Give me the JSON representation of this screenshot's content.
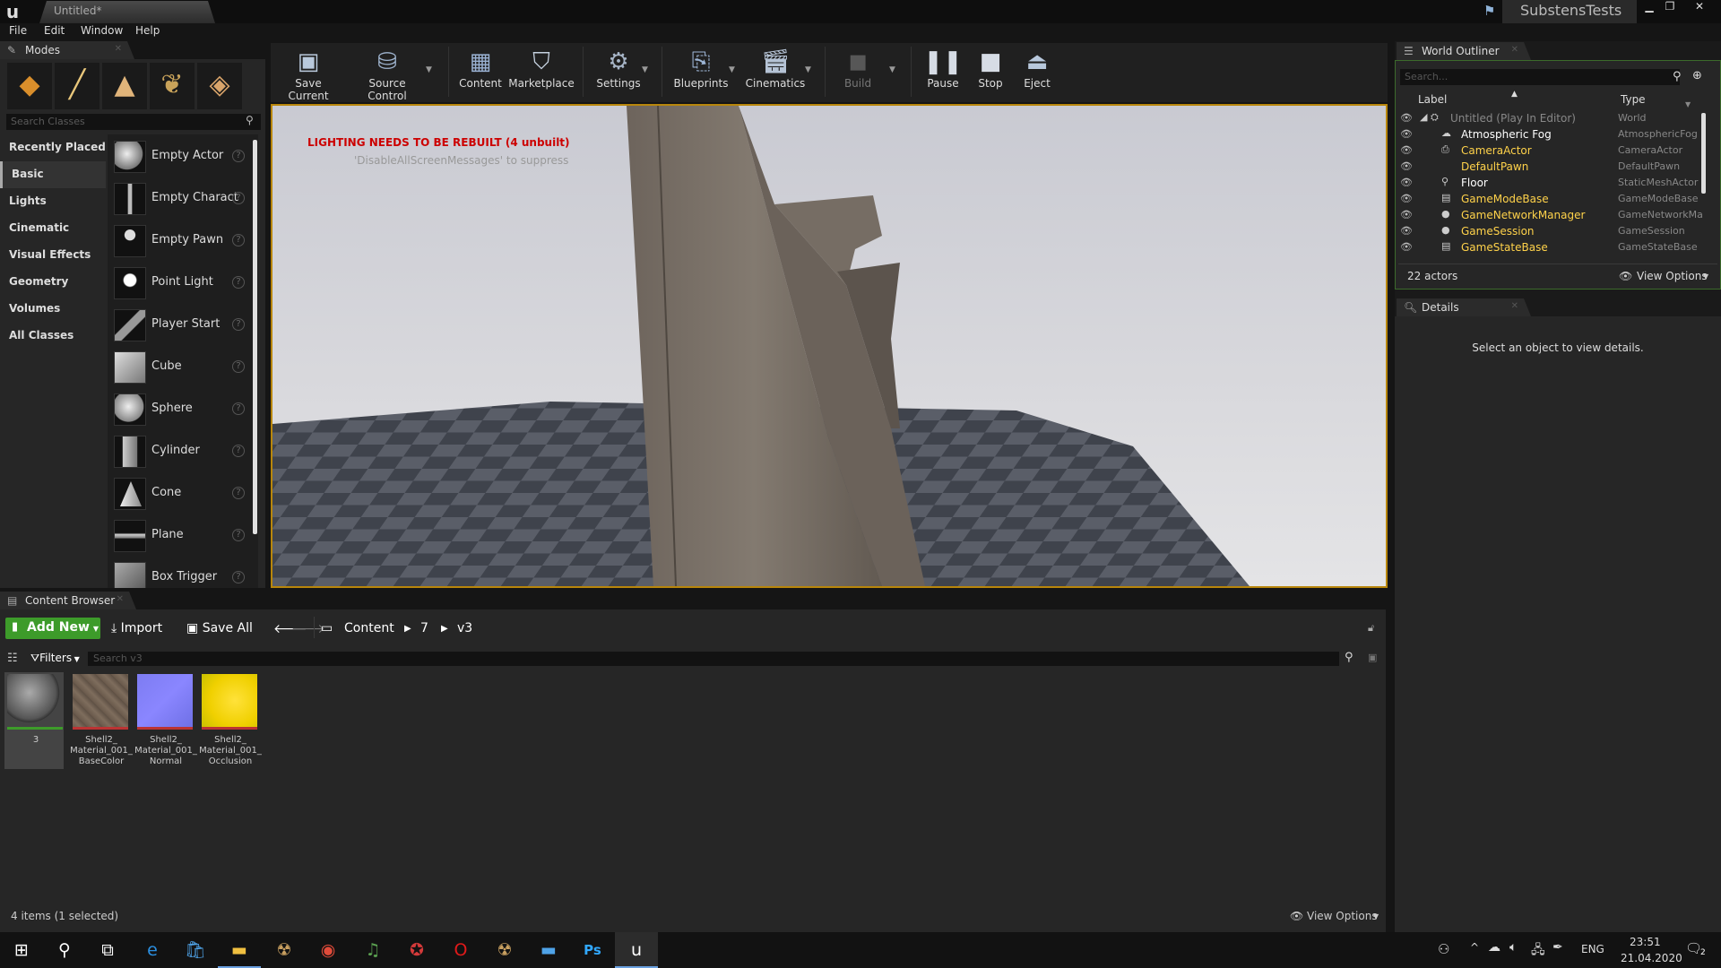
{
  "title_bar": {
    "doc_tab": "Untitled*",
    "project": "SubstensTests",
    "win_min": "▁",
    "win_max": "❐",
    "win_close": "✕"
  },
  "menu": [
    "File",
    "Edit",
    "Window",
    "Help"
  ],
  "modes": {
    "tab": "Modes",
    "search_placeholder": "Search Classes",
    "categories": [
      "Recently Placed",
      "Basic",
      "Lights",
      "Cinematic",
      "Visual Effects",
      "Geometry",
      "Volumes",
      "All Classes"
    ],
    "items": [
      "Empty Actor",
      "Empty Charact",
      "Empty Pawn",
      "Point Light",
      "Player Start",
      "Cube",
      "Sphere",
      "Cylinder",
      "Cone",
      "Plane",
      "Box Trigger"
    ]
  },
  "toolbar": {
    "save_current": "Save Current",
    "source_control": "Source Control",
    "content": "Content",
    "marketplace": "Marketplace",
    "settings": "Settings",
    "blueprints": "Blueprints",
    "cinematics": "Cinematics",
    "build": "Build",
    "pause": "Pause",
    "stop": "Stop",
    "eject": "Eject"
  },
  "viewport": {
    "warning": "LIGHTING NEEDS TO BE REBUILT (4 unbuilt)",
    "suppress_hint": "'DisableAllScreenMessages' to suppress"
  },
  "outliner": {
    "tab": "World Outliner",
    "search_placeholder": "Search...",
    "col_label": "Label",
    "col_type": "Type",
    "rows": [
      {
        "label": "Untitled (Play In Editor)",
        "type": "World"
      },
      {
        "label": "Atmospheric Fog",
        "type": "AtmosphericFog"
      },
      {
        "label": "CameraActor",
        "type": "CameraActor"
      },
      {
        "label": "DefaultPawn",
        "type": "DefaultPawn"
      },
      {
        "label": "Floor",
        "type": "StaticMeshActor"
      },
      {
        "label": "GameModeBase",
        "type": "GameModeBase"
      },
      {
        "label": "GameNetworkManager",
        "type": "GameNetworkMa"
      },
      {
        "label": "GameSession",
        "type": "GameSession"
      },
      {
        "label": "GameStateBase",
        "type": "GameStateBase"
      }
    ],
    "count": "22 actors",
    "view_options": "View Options"
  },
  "details": {
    "tab": "Details",
    "empty_msg": "Select an object to view details."
  },
  "content_browser": {
    "tab": "Content Browser",
    "add_new": "Add New",
    "import": "Import",
    "save_all": "Save All",
    "path": [
      "Content",
      "7",
      "v3"
    ],
    "filters": "Filters",
    "search_placeholder": "Search v3",
    "assets": [
      {
        "label": "3"
      },
      {
        "label": "Shell2_ Material_001_ BaseColor"
      },
      {
        "label": "Shell2_ Material_001_ Normal"
      },
      {
        "label": "Shell2_ Material_001_ Occlusion"
      }
    ],
    "status": "4 items (1 selected)",
    "view_options": "View Options"
  },
  "taskbar": {
    "lang": "ENG",
    "time": "23:51",
    "date": "21.04.2020",
    "notif": "2"
  },
  "colors": {
    "accent_green": "#3d9b2a",
    "warning_red": "#cc0000",
    "selection_gold": "#b8860b"
  }
}
